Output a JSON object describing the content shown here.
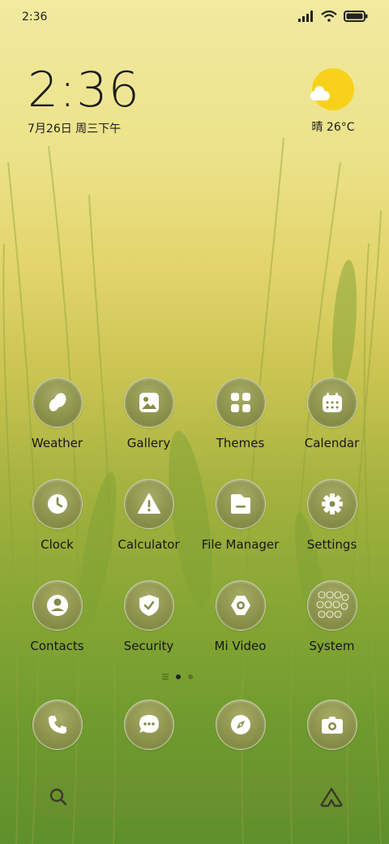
{
  "status_bar": {
    "time": "2:36",
    "icons": [
      "signal-icon",
      "wifi-icon",
      "battery-icon"
    ]
  },
  "clock_widget": {
    "time": "2:36",
    "date": "7月26日 周三下午"
  },
  "weather_widget": {
    "condition_temp": "晴 26°C",
    "icon": "sunny-cloud-icon"
  },
  "apps": [
    {
      "label": "Weather",
      "icon": "weather-icon"
    },
    {
      "label": "Gallery",
      "icon": "gallery-icon"
    },
    {
      "label": "Themes",
      "icon": "themes-icon"
    },
    {
      "label": "Calendar",
      "icon": "calendar-icon"
    },
    {
      "label": "Clock",
      "icon": "clock-icon"
    },
    {
      "label": "Calculator",
      "icon": "calculator-icon"
    },
    {
      "label": "File Manager",
      "icon": "folder-icon"
    },
    {
      "label": "Settings",
      "icon": "gear-icon"
    },
    {
      "label": "Contacts",
      "icon": "contacts-icon"
    },
    {
      "label": "Security",
      "icon": "shield-icon"
    },
    {
      "label": "Mi Video",
      "icon": "video-icon"
    },
    {
      "label": "System",
      "icon": "folder-grid-icon"
    }
  ],
  "page_indicator": {
    "pages": 2,
    "current": 1
  },
  "dock": [
    "phone-icon",
    "message-icon",
    "browser-icon",
    "camera-icon"
  ],
  "search_bar": {
    "left_icon": "search-icon",
    "right_icon": "assistant-icon"
  },
  "colors": {
    "icon_bg": "#858c45",
    "sun": "#f8d21a",
    "text": "#161616"
  }
}
